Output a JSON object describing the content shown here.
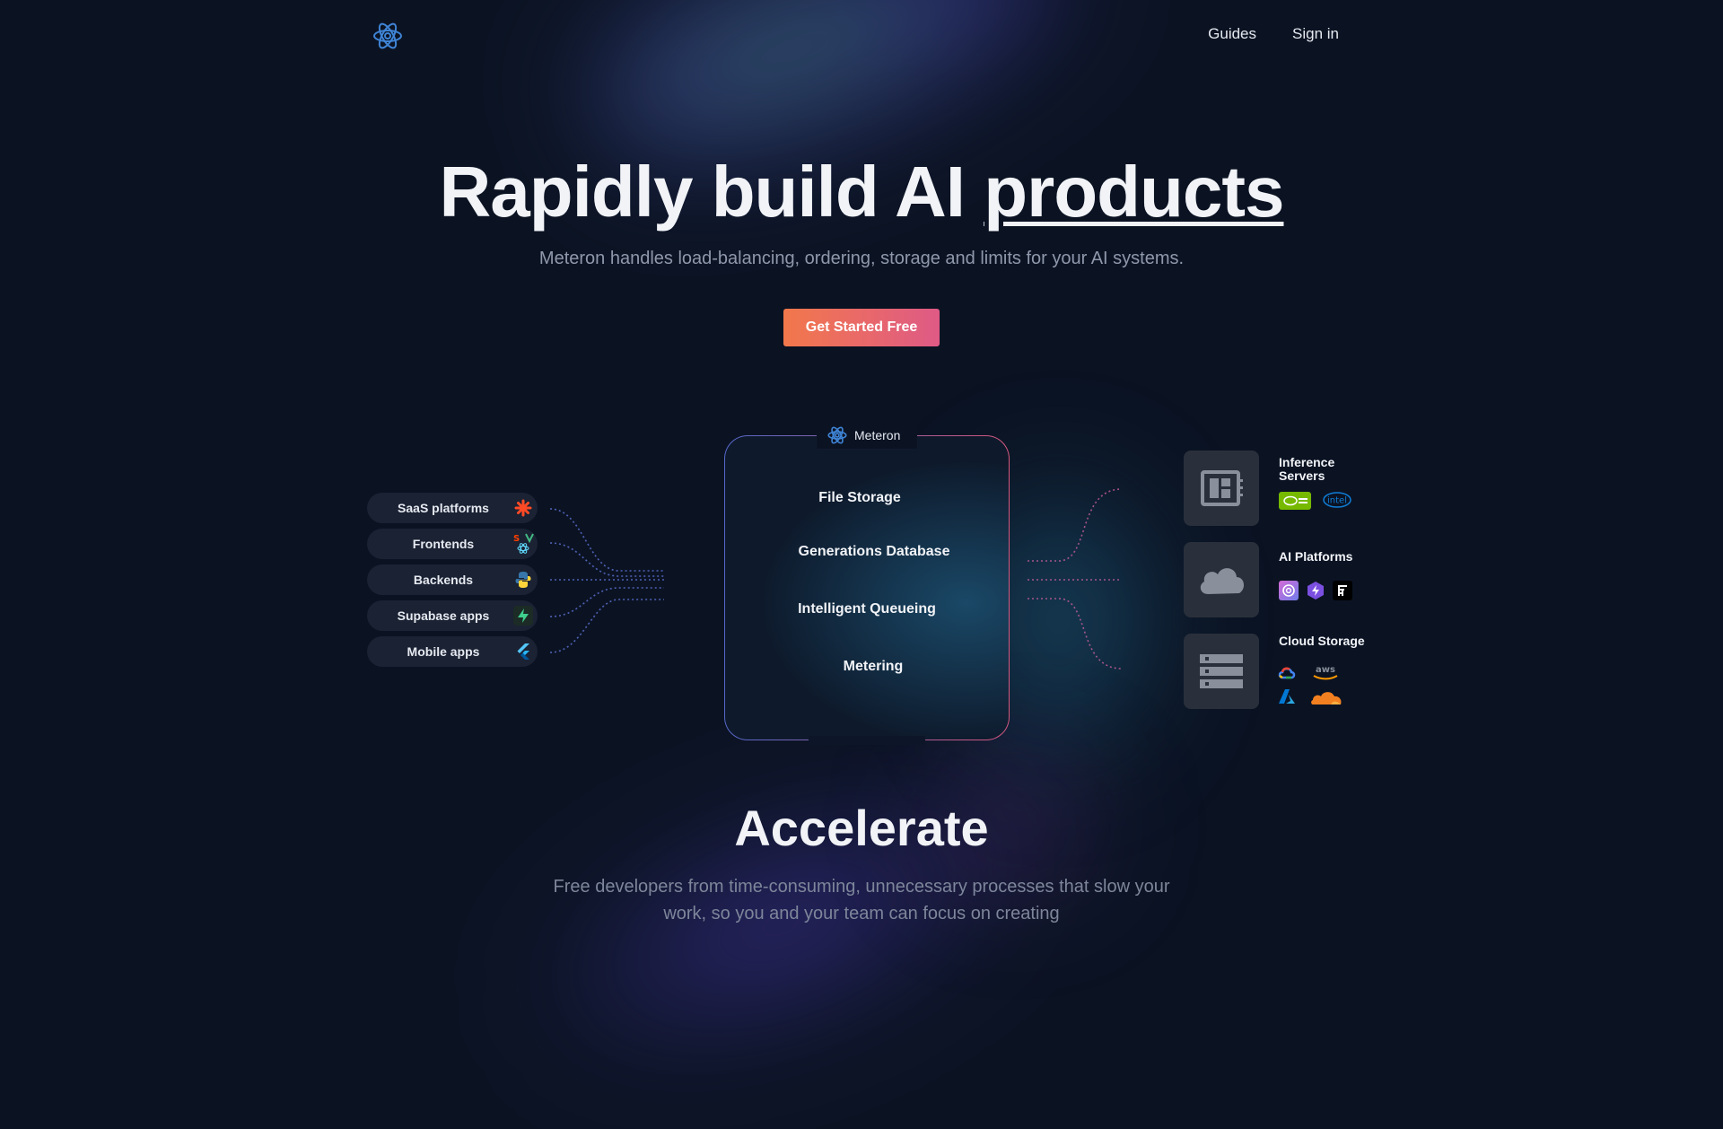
{
  "nav": {
    "guides": "Guides",
    "sign_in": "Sign in"
  },
  "hero": {
    "title_main": "Rapidly build AI ",
    "title_underlined": "products",
    "subtitle": "Meteron handles load-balancing, ordering, storage and limits for your AI systems.",
    "cta": "Get Started Free"
  },
  "sources": [
    {
      "label": "SaaS platforms",
      "icon": "asterisk-icon"
    },
    {
      "label": "Frontends",
      "icon": "frontend-frameworks-icon"
    },
    {
      "label": "Backends",
      "icon": "python-icon"
    },
    {
      "label": "Supabase apps",
      "icon": "supabase-icon"
    },
    {
      "label": "Mobile apps",
      "icon": "flutter-icon"
    }
  ],
  "core": {
    "name": "Meteron",
    "features": [
      "File Storage",
      "Generations Database",
      "Intelligent Queueing",
      "Metering"
    ]
  },
  "targets": [
    {
      "title": "Inference Servers",
      "icon": "server-board-icon"
    },
    {
      "title": "AI Platforms",
      "icon": "cloud-icon"
    },
    {
      "title": "Cloud Storage",
      "icon": "storage-rack-icon"
    }
  ],
  "accelerate": {
    "title": "Accelerate",
    "subtitle": "Free developers from time-consuming, unnecessary processes that slow your work, so you and your team can focus on creating"
  },
  "colors": {
    "background": "#0b1323",
    "cta_start": "#f2784b",
    "cta_end": "#df5a86",
    "border_start": "#5567c9",
    "border_end": "#d6577e"
  }
}
